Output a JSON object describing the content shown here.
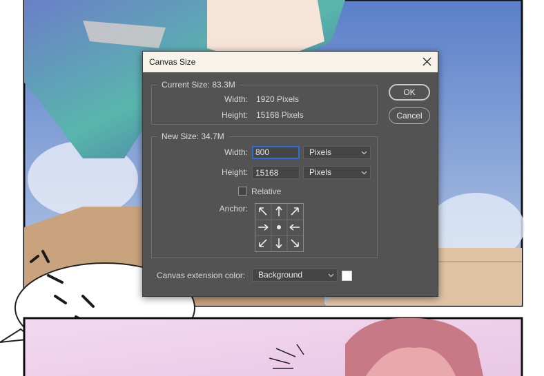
{
  "dialog": {
    "title": "Canvas Size",
    "current_size": {
      "legend": "Current Size: 83.3M",
      "width_label": "Width:",
      "width_value": "1920 Pixels",
      "height_label": "Height:",
      "height_value": "15168 Pixels"
    },
    "new_size": {
      "legend": "New Size: 34.7M",
      "width_label": "Width:",
      "width_value": "800",
      "width_unit": "Pixels",
      "height_label": "Height:",
      "height_value": "15168",
      "height_unit": "Pixels",
      "relative_label": "Relative",
      "relative_checked": false,
      "anchor_label": "Anchor:"
    },
    "extension": {
      "label": "Canvas extension color:",
      "value": "Background",
      "swatch_color": "#ffffff"
    },
    "buttons": {
      "ok": "OK",
      "cancel": "Cancel"
    }
  },
  "colors": {
    "dialog_bg": "#535353",
    "focus_ring": "#2b6fd6",
    "titlebar": "#f7f2ea"
  }
}
